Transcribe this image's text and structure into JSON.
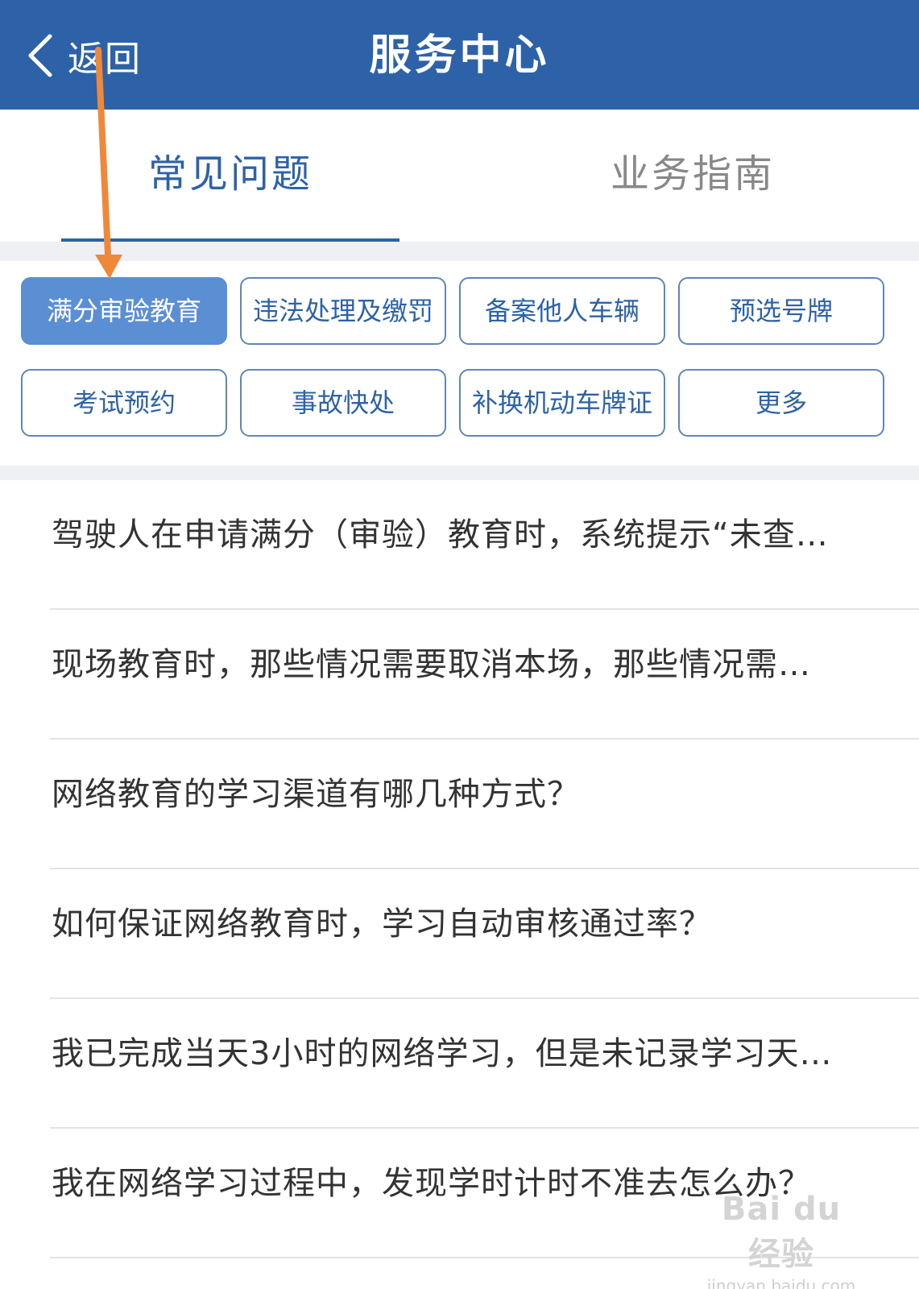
{
  "header": {
    "back_label": "返回",
    "title": "服务中心",
    "background": "#2d62a8"
  },
  "tabs": [
    {
      "label": "常见问题",
      "active": true
    },
    {
      "label": "业务指南",
      "active": false
    }
  ],
  "categories": [
    {
      "label": "满分审验教育",
      "active": true
    },
    {
      "label": "违法处理及缴罚",
      "active": false
    },
    {
      "label": "备案他人车辆",
      "active": false
    },
    {
      "label": "预选号牌",
      "active": false
    },
    {
      "label": "考试预约",
      "active": false
    },
    {
      "label": "事故快处",
      "active": false
    },
    {
      "label": "补换机动车牌证",
      "active": false
    },
    {
      "label": "更多",
      "active": false
    }
  ],
  "faq": [
    {
      "text": "驾驶人在申请满分（审验）教育时，系统提示“未查…"
    },
    {
      "text": "现场教育时，那些情况需要取消本场，那些情况需…"
    },
    {
      "text": "网络教育的学习渠道有哪几种方式？"
    },
    {
      "text": "如何保证网络教育时，学习自动审核通过率？"
    },
    {
      "text": "我已完成当天3小时的网络学习，但是未记录学习天…"
    },
    {
      "text": "我在网络学习过程中，发现学时计时不准去怎么办？"
    }
  ],
  "watermark": {
    "logo": "Bai du 经验",
    "url": "jingyan.baidu.com"
  },
  "colors": {
    "accent": "#2d62a8",
    "active_chip": "#5b8fd4",
    "annotation_arrow": "#f0883a"
  }
}
